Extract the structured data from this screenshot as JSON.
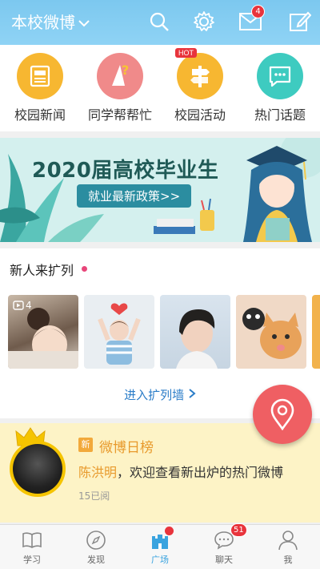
{
  "header": {
    "title": "本校微博",
    "mail_badge": "4",
    "icons": [
      "search-icon",
      "gear-icon",
      "mail-icon",
      "edit-icon"
    ]
  },
  "quick_entries": [
    {
      "label": "校园新闻",
      "icon": "news-icon",
      "color": "#f7b731"
    },
    {
      "label": "同学帮帮忙",
      "icon": "help-icon",
      "color": "#f08a8a"
    },
    {
      "label": "校园活动",
      "icon": "signpost-icon",
      "color": "#f7b731",
      "tag": "HOT"
    },
    {
      "label": "热门话题",
      "icon": "chat-icon",
      "color": "#3ecbc0"
    }
  ],
  "banner": {
    "title": "2020届高校毕业生",
    "subtitle": "就业最新政策>>"
  },
  "new_people": {
    "title": "新人来扩列",
    "link": "进入扩列墙",
    "video_time": "4",
    "photos": [
      "photo-parent-child",
      "photo-toddler-heart",
      "photo-boy-profile",
      "photo-cats"
    ]
  },
  "rank": {
    "tag": "新",
    "title": "微博日榜",
    "name": "陈洪明",
    "message": "，欢迎查看新出炉的热门微博",
    "meta": "15已阅"
  },
  "tabbar": {
    "items": [
      {
        "label": "学习",
        "icon": "book-icon"
      },
      {
        "label": "发现",
        "icon": "compass-icon"
      },
      {
        "label": "广场",
        "icon": "castle-icon",
        "active": true
      },
      {
        "label": "聊天",
        "icon": "chat-bubble-icon",
        "badge": "51"
      },
      {
        "label": "我",
        "icon": "person-icon"
      }
    ]
  },
  "colors": {
    "header": "#8fd3f5",
    "accent": "#39a3df",
    "badge": "#e8343c",
    "fab": "#ef5f63",
    "rank_bg": "#fdf3c6"
  }
}
